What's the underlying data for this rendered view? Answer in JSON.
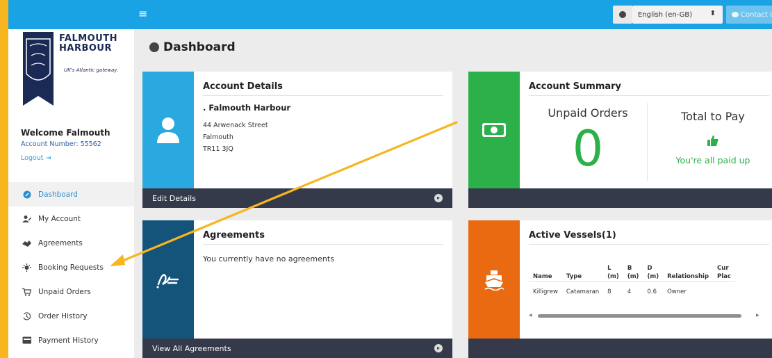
{
  "topbar": {
    "menu_glyph": "≡",
    "language_value": "English (en-GB)",
    "language_arrow": "⬍",
    "contact_label": "Contact U"
  },
  "sidebar": {
    "logo_line1": "FALMOUTH",
    "logo_line2": "HARBOUR",
    "logo_tagline": "UK's Atlantic gateway.",
    "welcome": "Welcome Falmouth",
    "account_number": "Account Number: 55562",
    "logout": "Logout ⇥",
    "items": [
      {
        "label": "Dashboard",
        "icon": "dashboard-icon",
        "active": true
      },
      {
        "label": "My Account",
        "icon": "user-icon"
      },
      {
        "label": "Agreements",
        "icon": "handshake-icon"
      },
      {
        "label": "Booking Requests",
        "icon": "booking-icon"
      },
      {
        "label": "Unpaid Orders",
        "icon": "cart-icon"
      },
      {
        "label": "Order History",
        "icon": "history-icon"
      },
      {
        "label": "Payment History",
        "icon": "payment-icon"
      }
    ]
  },
  "main": {
    "title": "Dashboard",
    "account_details": {
      "heading": "Account Details",
      "name": ". Falmouth Harbour",
      "line1": "44 Arwenack Street",
      "line2": "Falmouth",
      "line3": "TR11 3JQ",
      "footer": "Edit Details"
    },
    "account_summary": {
      "heading": "Account Summary",
      "unpaid_label": "Unpaid Orders",
      "unpaid_count": "0",
      "total_label": "Total to Pay",
      "paid_text": "You're all paid up"
    },
    "agreements": {
      "heading": "Agreements",
      "empty_text": "You currently have no agreements",
      "footer": "View All Agreements"
    },
    "vessels": {
      "heading": "Active Vessels(1)",
      "columns": [
        "Name",
        "Type",
        "L\n(m)",
        "B\n(m)",
        "D\n(m)",
        "Relationship",
        "Cur\nPlac"
      ],
      "rows": [
        [
          "Killigrew",
          "Catamaran",
          "8",
          "4",
          "0.6",
          "Owner",
          ""
        ]
      ]
    }
  },
  "colors": {
    "topbar": "#19a3e5",
    "details_side": "#29a9e0",
    "summary_side": "#2bb04a",
    "agreements_side": "#14537a",
    "vessels_side": "#ea6a12",
    "annotation_arrow": "#f7b51f",
    "footer": "#353a4b"
  }
}
